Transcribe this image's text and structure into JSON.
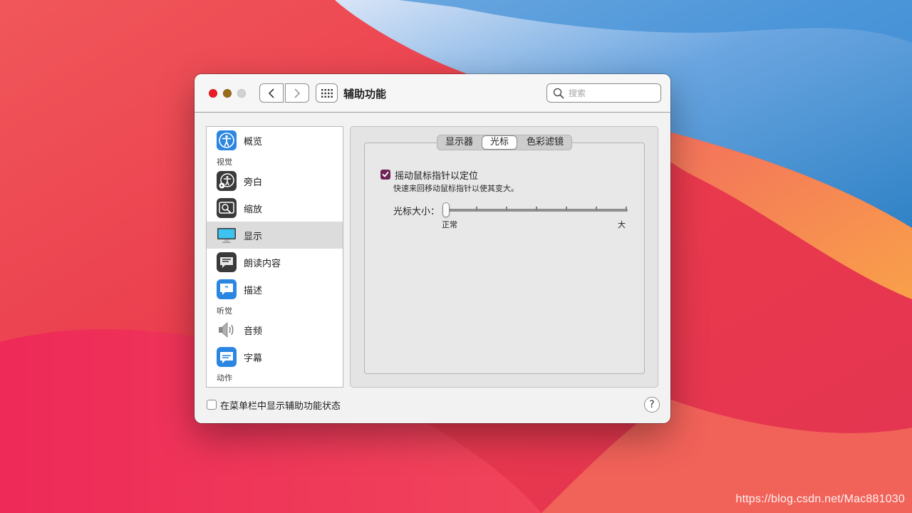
{
  "window": {
    "title": "辅助功能",
    "search_placeholder": "搜索"
  },
  "sidebar": {
    "categories": {
      "vision": "视觉",
      "hearing": "听觉",
      "motion": "动作"
    },
    "items": [
      {
        "label": "概览",
        "icon": "accessibility-icon"
      },
      {
        "label": "旁白",
        "icon": "voiceover-icon"
      },
      {
        "label": "缩放",
        "icon": "zoom-icon"
      },
      {
        "label": "显示",
        "icon": "display-icon",
        "selected": true
      },
      {
        "label": "朗读内容",
        "icon": "spoken-content-icon"
      },
      {
        "label": "描述",
        "icon": "descriptions-icon"
      },
      {
        "label": "音频",
        "icon": "speaker-icon"
      },
      {
        "label": "字幕",
        "icon": "captions-icon"
      }
    ]
  },
  "tabs": [
    {
      "label": "显示器"
    },
    {
      "label": "光标",
      "active": true
    },
    {
      "label": "色彩滤镜"
    }
  ],
  "cursor": {
    "shake_label": "摇动鼠标指针以定位",
    "shake_checked": true,
    "shake_hint": "快速来回移动鼠标指针以使其变大。",
    "size_label": "光标大小：",
    "size_min_label": "正常",
    "size_max_label": "大",
    "size_value": 0
  },
  "footer": {
    "menubar_status_label": "在菜单栏中显示辅助功能状态",
    "menubar_status_checked": false,
    "help_label": "?"
  },
  "watermark": "https://blog.csdn.net/Mac881030",
  "colors": {
    "checkbox_accent": "#6d2556",
    "close": "#ec1c24",
    "minimize": "#9a6c1a",
    "selected_row": "#dcdcdc"
  }
}
